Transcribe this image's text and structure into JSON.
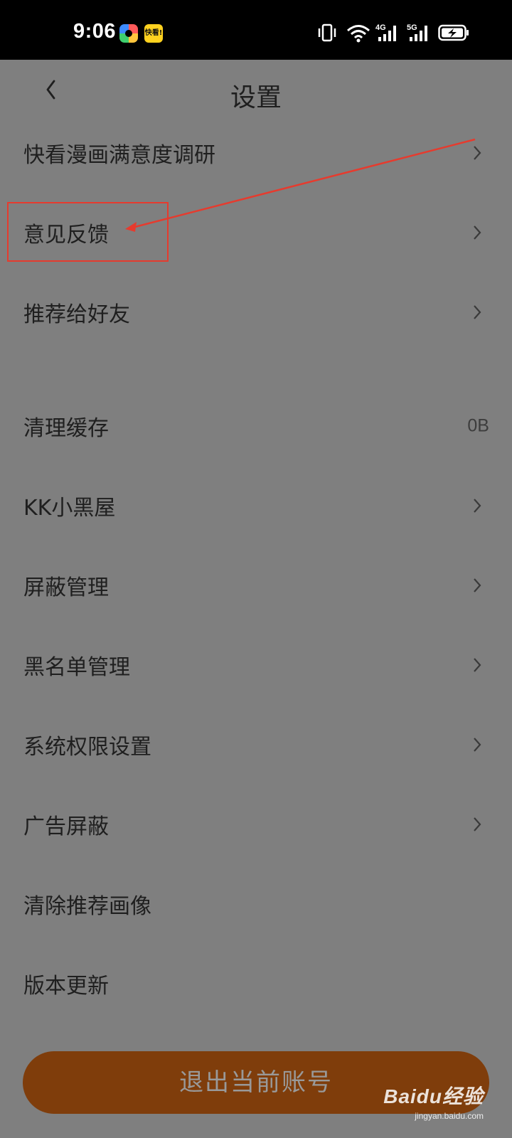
{
  "status_bar": {
    "time": "9:06",
    "app_badge_text": "快看!",
    "network_1": "4G",
    "network_2": "5G"
  },
  "header": {
    "title": "设置"
  },
  "menu": {
    "items": [
      {
        "label": "快看漫画满意度调研",
        "chevron": true
      },
      {
        "label": "意见反馈",
        "chevron": true
      },
      {
        "label": "推荐给好友",
        "chevron": true
      },
      {
        "label": "清理缓存",
        "value": "0B"
      },
      {
        "label": "KK小黑屋",
        "chevron": true
      },
      {
        "label": "屏蔽管理",
        "chevron": true
      },
      {
        "label": "黑名单管理",
        "chevron": true
      },
      {
        "label": "系统权限设置",
        "chevron": true
      },
      {
        "label": "广告屏蔽",
        "chevron": true
      },
      {
        "label": "清除推荐画像",
        "chevron": false
      },
      {
        "label": "版本更新",
        "chevron": false
      }
    ]
  },
  "logout": {
    "label": "退出当前账号"
  },
  "watermark": {
    "brand": "Baidu经验",
    "url": "jingyan.baidu.com"
  },
  "colors": {
    "overlay_bg": "#7f7f7f",
    "logout_bg": "#7f3d0b",
    "annotation": "#e63b2e"
  }
}
